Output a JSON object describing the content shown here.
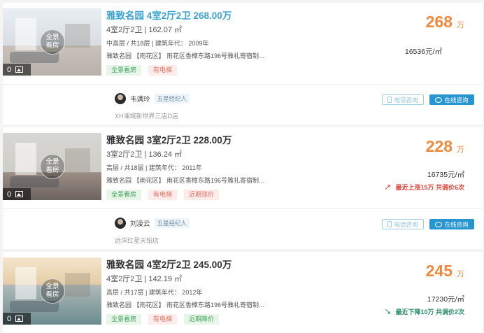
{
  "listings": [
    {
      "title": "雅致名园 4室2厅2卫 268.00万",
      "area_line": "4室2厅2卫 | 162.07 ㎡",
      "floor_line": "中高层 / 共18层 | 建筑年代： 2009年",
      "address": "雅致名园 【雨花区】 雨花区香樟东路196号雅礼寄宿制...",
      "photo_count": "0",
      "pano_label_1": "全景",
      "pano_label_2": "看房",
      "tags": [
        "全景看房",
        "有电梯"
      ],
      "price": "268",
      "price_unit": "万",
      "unit_price": "16536元/㎡",
      "agent_name": "韦满玲",
      "agent_level": "五星经纪人",
      "store": "XH湘城新世界三店D店",
      "phone_label": "电话咨询",
      "chat_label": "在线咨询"
    },
    {
      "title": "雅致名园 3室2厅2卫 228.00万",
      "area_line": "3室2厅2卫 | 136.24 ㎡",
      "floor_line": "高层 / 共18层 | 建筑年代： 2011年",
      "address": "雅致名园 【雨花区】 雨花区香樟东路196号雅礼寄宿制...",
      "photo_count": "0",
      "pano_label_1": "全景",
      "pano_label_2": "看房",
      "tags": [
        "全景看房",
        "有电梯",
        "近期涨价"
      ],
      "price": "228",
      "price_unit": "万",
      "unit_price": "16735元/㎡",
      "trend_text": "最近上涨15万 共调价6次",
      "agent_name": "刘凌云",
      "agent_level": "五星经纪人",
      "store": "远洋红星天铂店",
      "phone_label": "电话咨询",
      "chat_label": "在线咨询"
    },
    {
      "title": "雅致名园 4室2厅2卫 245.00万",
      "area_line": "4室2厅2卫 | 142.19 ㎡",
      "floor_line": "高层 / 共17层 | 建筑年代： 2012年",
      "address": "雅致名园 【雨花区】 雨花区香樟东路196号雅礼寄宿制...",
      "photo_count": "0",
      "pano_label_1": "全景",
      "pano_label_2": "看房",
      "tags": [
        "全景看房",
        "有电梯",
        "近期降价"
      ],
      "price": "245",
      "price_unit": "万",
      "unit_price": "17230元/㎡",
      "trend_text": "最近下降10万 共调价2次"
    }
  ],
  "colors": {
    "price": "#f0893a",
    "title_active": "#3ba3d0",
    "trend_up": "#e0483e",
    "trend_down": "#2a8f6a",
    "chat_button": "#2795d0"
  },
  "icons": {
    "photo": "image-icon",
    "trend_up": "trend-up-icon",
    "trend_down": "trend-down-icon",
    "phone": "phone-icon",
    "chat": "chat-icon"
  }
}
